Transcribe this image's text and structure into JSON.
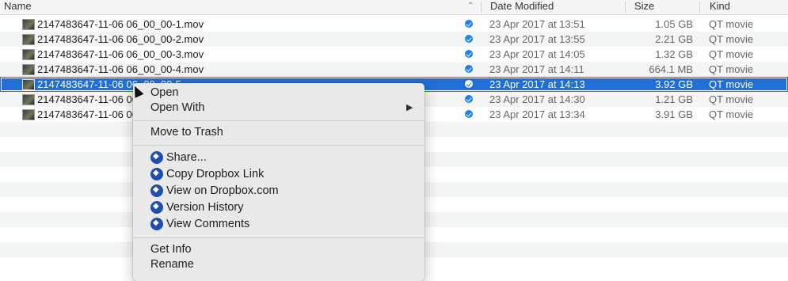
{
  "columns": {
    "name": "Name",
    "date_modified": "Date Modified",
    "size": "Size",
    "kind": "Kind"
  },
  "files": [
    {
      "name": "2147483647-11-06 06_00_00-1.mov",
      "date": "23 Apr 2017 at 13:51",
      "size": "1.05 GB",
      "kind": "QT movie"
    },
    {
      "name": "2147483647-11-06 06_00_00-2.mov",
      "date": "23 Apr 2017 at 13:55",
      "size": "2.21 GB",
      "kind": "QT movie"
    },
    {
      "name": "2147483647-11-06 06_00_00-3.mov",
      "date": "23 Apr 2017 at 14:05",
      "size": "1.32 GB",
      "kind": "QT movie"
    },
    {
      "name": "2147483647-11-06 06_00_00-4.mov",
      "date": "23 Apr 2017 at 14:11",
      "size": "664.1 MB",
      "kind": "QT movie"
    },
    {
      "name": "2147483647-11-06 06_00_00-5",
      "date": "23 Apr 2017 at 14:13",
      "size": "3.92 GB",
      "kind": "QT movie",
      "selected": true
    },
    {
      "name": "2147483647-11-06 06",
      "date": "23 Apr 2017 at 14:30",
      "size": "1.21 GB",
      "kind": "QT movie"
    },
    {
      "name": "2147483647-11-06 06",
      "date": "23 Apr 2017 at 13:34",
      "size": "3.91 GB",
      "kind": "QT movie"
    }
  ],
  "context_menu": {
    "open": "Open",
    "open_with": "Open With",
    "move_to_trash": "Move to Trash",
    "dropbox": {
      "share": "Share...",
      "copy_link": "Copy Dropbox Link",
      "view_on_dropbox": "View on Dropbox.com",
      "version_history": "Version History",
      "view_comments": "View Comments"
    },
    "get_info": "Get Info",
    "rename": "Rename"
  },
  "colors": {
    "selection": "#1e6fd8",
    "dropbox_icon": "#1f4fa8",
    "sync_badge": "#1f7ff0"
  }
}
